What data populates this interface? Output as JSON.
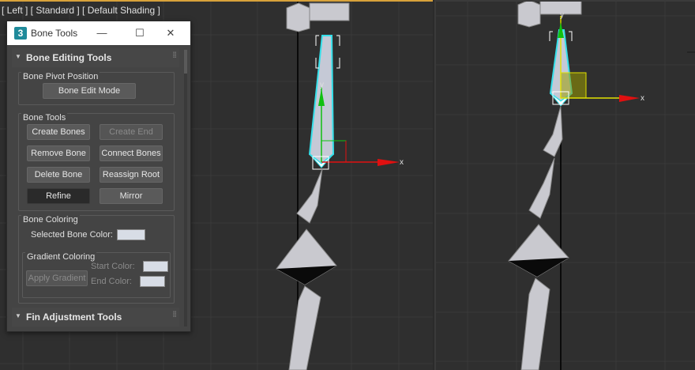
{
  "viewport_left": {
    "label": "[ Left ] [ Standard ] [ Default Shading ]"
  },
  "viewport_right": {
    "label": ""
  },
  "gizmo": {
    "x_axis": "x",
    "y_axis": "y"
  },
  "dialog": {
    "app_icon": "3",
    "title": "Bone Tools",
    "min_label": "—",
    "max_label": "☐",
    "close_label": "✕",
    "rollout_editing": {
      "title": "Bone Editing Tools",
      "pivot_group": {
        "title": "Bone Pivot Position",
        "edit_mode_label": "Bone Edit Mode"
      },
      "tools_group": {
        "title": "Bone Tools",
        "create_bones": "Create Bones",
        "create_end": "Create End",
        "remove_bone": "Remove Bone",
        "connect_bones": "Connect Bones",
        "delete_bone": "Delete Bone",
        "reassign_root": "Reassign Root",
        "refine": "Refine",
        "mirror": "Mirror"
      },
      "coloring_group": {
        "title": "Bone Coloring",
        "selected_color_label": "Selected Bone Color:",
        "selected_color": "#d8dde6",
        "gradient": {
          "title": "Gradient Coloring",
          "apply_label": "Apply Gradient",
          "start_label": "Start Color:",
          "end_label": "End Color:",
          "start_color": "#d8dde6",
          "end_color": "#d8dde6"
        }
      }
    },
    "rollout_fin": {
      "title": "Fin Adjustment Tools"
    }
  },
  "colors": {
    "active_border": "#d8a23a",
    "selection": "#35e0ea",
    "x_axis": "#e01010",
    "y_axis": "#10c010",
    "gizmo_plane": "#e0e000"
  }
}
